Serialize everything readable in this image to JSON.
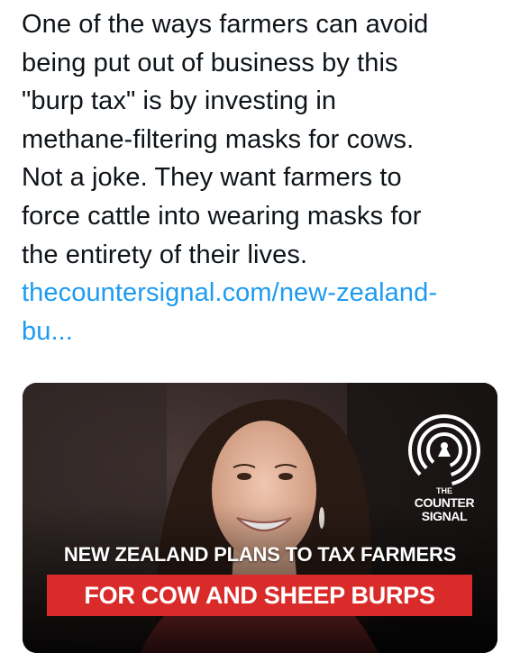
{
  "tweet": {
    "lines": [
      "One of the ways farmers can avoid",
      "being put out of business by this",
      "\"burp tax\" is by investing in",
      "methane-filtering masks for cows.",
      "Not a joke. They want farmers to",
      "force cattle into wearing masks for",
      "the entirety of their lives."
    ],
    "link_lines": [
      "thecountersignal.com/new-zealand-",
      "bu..."
    ]
  },
  "card": {
    "logo_the": "THE",
    "logo_counter": "COUNTER",
    "logo_signal": "SIGNAL",
    "headline": "NEW ZEALAND PLANS TO TAX FARMERS",
    "banner": "FOR COW AND SHEEP BURPS"
  },
  "colors": {
    "link": "#1d9bf0",
    "banner": "#d92c2a",
    "text": "#0f1419"
  }
}
